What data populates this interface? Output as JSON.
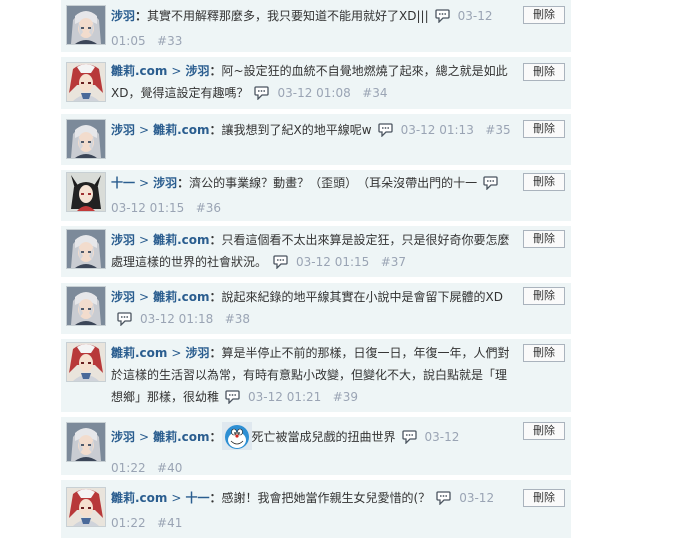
{
  "delete_label": "刪除",
  "comments": [
    {
      "avatar": "silver-hair",
      "users": [
        "涉羽"
      ],
      "text": "其實不用解釋那麼多，我只要知道不能用就好了XD|||",
      "time": "03-12 01:05",
      "num": "#33"
    },
    {
      "avatar": "red-hair",
      "users": [
        "雛莉.com",
        "涉羽"
      ],
      "text": "阿~設定狂的血統不自覺地燃燒了起來，總之就是如此XD，覺得這設定有趣嗎？",
      "time": "03-12 01:08",
      "num": "#34"
    },
    {
      "avatar": "silver-hair",
      "users": [
        "涉羽",
        "雛莉.com"
      ],
      "text": "讓我想到了紀X的地平線呢w",
      "time": "03-12 01:13",
      "num": "#35"
    },
    {
      "avatar": "cat-ears",
      "users": [
        "十一",
        "涉羽"
      ],
      "text": "濟公的事業線？動畫？（歪頭）　（耳朵沒帶出門的十一",
      "time": "03-12 01:15",
      "num": "#36"
    },
    {
      "avatar": "silver-hair",
      "users": [
        "涉羽",
        "雛莉.com"
      ],
      "text": "只看這個看不太出來算是設定狂，只是很好奇你要怎麼處理這樣的世界的社會狀況。",
      "time": "03-12 01:15",
      "num": "#37"
    },
    {
      "avatar": "silver-hair",
      "users": [
        "涉羽",
        "雛莉.com"
      ],
      "text": "說起來紀錄的地平線其實在小說中是會留下屍體的XD",
      "time": "03-12 01:18",
      "num": "#38"
    },
    {
      "avatar": "red-hair",
      "users": [
        "雛莉.com",
        "涉羽"
      ],
      "text": "算是半停止不前的那樣，日復一日，年復一年，人們對於這樣的生活習以為常，有時有意點小改變，但變化不大，說白點就是「理想鄉」那樣，很幼稚",
      "time": "03-12 01:21",
      "num": "#39"
    },
    {
      "avatar": "silver-hair",
      "users": [
        "涉羽",
        "雛莉.com"
      ],
      "text": "死亡被當成兒戲的扭曲世界",
      "time": "03-12 01:22",
      "num": "#40",
      "emoji": "doraemon"
    },
    {
      "avatar": "red-hair",
      "users": [
        "雛莉.com",
        "十一"
      ],
      "text": "感謝！我會把她當作親生女兒愛惜的(？",
      "time": "03-12 01:22",
      "num": "#41"
    }
  ]
}
